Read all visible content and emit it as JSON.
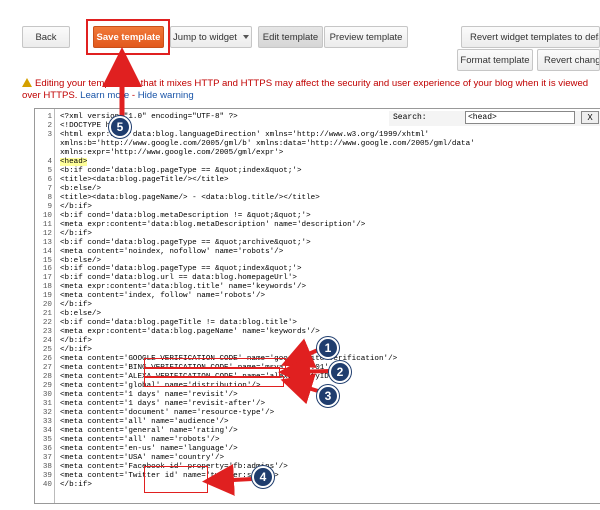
{
  "toolbar": {
    "back_label": "Back",
    "save_label": "Save template",
    "jump_label": "Jump to widget",
    "edit_label": "Edit template",
    "preview_label": "Preview template",
    "revert_widget_label": "Revert widget templates to default",
    "format_label": "Format template",
    "revert_change_label": "Revert changes"
  },
  "warning": {
    "text": "Editing your template so that it mixes HTTP and HTTPS may affect the security and user experience of your blog when it is viewed over HTTPS.",
    "learn_more": "Learn more",
    "hide": "Hide warning"
  },
  "search": {
    "label": "Search:",
    "value": "<head>",
    "close": "X"
  },
  "code_lines": [
    {
      "num": "1",
      "text": "<?xml version=\"1.0\" encoding=\"UTF-8\" ?>"
    },
    {
      "num": "2",
      "text": "<!DOCTYPE html>"
    },
    {
      "num": "3",
      "text": "<html expr:dir='data:blog.languageDirection' xmlns='http://www.w3.org/1999/xhtml'"
    },
    {
      "num": "",
      "text": "xmlns:b='http://www.google.com/2005/gml/b' xmlns:data='http://www.google.com/2005/gml/data'"
    },
    {
      "num": "",
      "text": "xmlns:expr='http://www.google.com/2005/gml/expr'>"
    },
    {
      "num": "4",
      "text": "<head>",
      "hl": true
    },
    {
      "num": "5",
      "text": "<b:if cond='data:blog.pageType == &quot;index&quot;'>"
    },
    {
      "num": "6",
      "text": "<title><data:blog.pageTitle/></title>"
    },
    {
      "num": "7",
      "text": "<b:else/>"
    },
    {
      "num": "8",
      "text": "<title><data:blog.pageName/> - <data:blog.title/></title>"
    },
    {
      "num": "9",
      "text": "</b:if>"
    },
    {
      "num": "10",
      "text": "<b:if cond='data:blog.metaDescription != &quot;&quot;'>"
    },
    {
      "num": "11",
      "text": "<meta expr:content='data:blog.metaDescription' name='description'/>"
    },
    {
      "num": "12",
      "text": "</b:if>"
    },
    {
      "num": "13",
      "text": "<b:if cond='data:blog.pageType == &quot;archive&quot;'>"
    },
    {
      "num": "14",
      "text": "<meta content='noindex, nofollow' name='robots'/>"
    },
    {
      "num": "15",
      "text": "<b:else/>"
    },
    {
      "num": "16",
      "text": "<b:if cond='data:blog.pageType == &quot;index&quot;'>"
    },
    {
      "num": "17",
      "text": "<b:if cond='data:blog.url == data:blog.homepageUrl'>"
    },
    {
      "num": "18",
      "text": "<meta expr:content='data:blog.title' name='keywords'/>"
    },
    {
      "num": "19",
      "text": "<meta content='index, follow' name='robots'/>"
    },
    {
      "num": "20",
      "text": "</b:if>"
    },
    {
      "num": "21",
      "text": "<b:else/>"
    },
    {
      "num": "22",
      "text": "<b:if cond='data:blog.pageTitle != data:blog.title'>"
    },
    {
      "num": "23",
      "text": "<meta expr:content='data:blog.pageName' name='keywords'/>"
    },
    {
      "num": "24",
      "text": "</b:if>"
    },
    {
      "num": "25",
      "text": "</b:if>"
    },
    {
      "num": "26",
      "text": "<meta content='GOOGLE VERIFICATION CODE' name='google-site-verification'/>"
    },
    {
      "num": "27",
      "text": "<meta content='BING VERIFICATION CODE' name='msvalidate.01'/>"
    },
    {
      "num": "28",
      "text": "<meta content='ALEXA VERIFICATION CODE' name='alexaVerifyID'/>"
    },
    {
      "num": "29",
      "text": "<meta content='global' name='distribution'/>"
    },
    {
      "num": "30",
      "text": "<meta content='1 days' name='revisit'/>"
    },
    {
      "num": "31",
      "text": "<meta content='1 days' name='revisit-after'/>"
    },
    {
      "num": "32",
      "text": "<meta content='document' name='resource-type'/>"
    },
    {
      "num": "33",
      "text": "<meta content='all' name='audience'/>"
    },
    {
      "num": "34",
      "text": "<meta content='general' name='rating'/>"
    },
    {
      "num": "35",
      "text": "<meta content='all' name='robots'/>"
    },
    {
      "num": "36",
      "text": "<meta content='en-us' name='language'/>"
    },
    {
      "num": "37",
      "text": "<meta content='USA' name='country'/>"
    },
    {
      "num": "38",
      "text": "<meta content='Facebook id' property='fb:admins'/>"
    },
    {
      "num": "39",
      "text": "<meta content='Twitter id' name='twitter:site'/>"
    },
    {
      "num": "40",
      "text": "</b:if>"
    }
  ],
  "callouts": [
    "1",
    "2",
    "3",
    "4",
    "5"
  ],
  "colors": {
    "accent": "#e2591c",
    "annotation": "#e02020",
    "badge": "#1f3d6e",
    "warning_text": "#c00000",
    "link": "#1a55a8",
    "highlight": "#ffff99"
  }
}
